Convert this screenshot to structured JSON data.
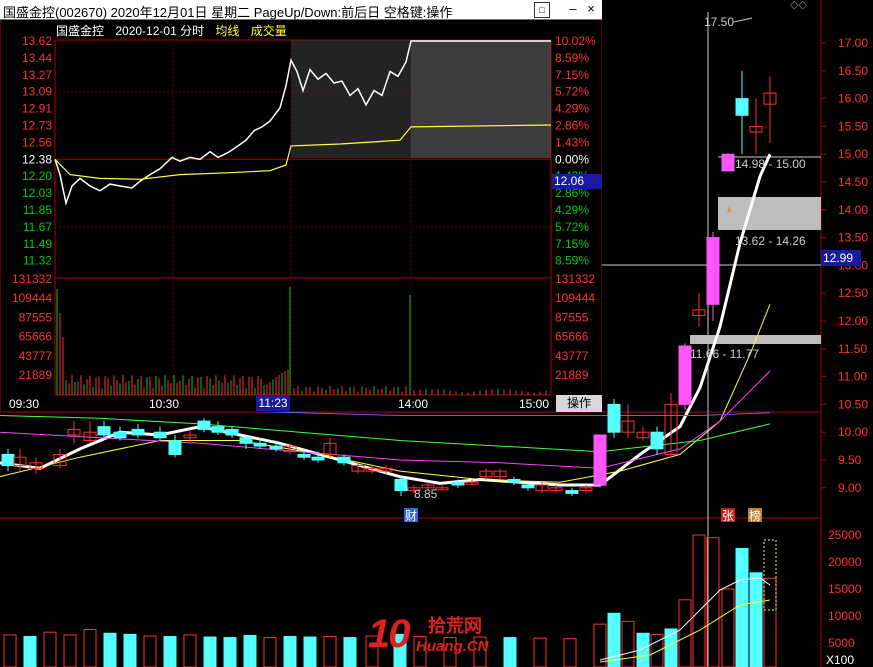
{
  "window": {
    "title": "国盛金控(002670) 2020年12月01日 星期二 PageUp/Down:前后日 空格键:操作",
    "operate_button": "操作"
  },
  "intraday": {
    "stock_name": "国盛金控",
    "date_label": "2020-12-01 分时",
    "legend_avg": "均线",
    "legend_vol": "成交量",
    "left_prices": [
      "13.62",
      "13.44",
      "13.27",
      "13.09",
      "12.91",
      "12.73",
      "12.56",
      "12.38",
      "12.20",
      "12.03",
      "11.85",
      "11.67",
      "11.49",
      "11.32"
    ],
    "right_pcts": [
      "10.02%",
      "8.59%",
      "7.15%",
      "5.72%",
      "4.29%",
      "2.86%",
      "1.43%",
      "0.00%",
      "1.43%",
      "2.86%",
      "4.29%",
      "5.72%",
      "7.15%",
      "8.59%"
    ],
    "vol_ticks": [
      "131332",
      "109444",
      "87555",
      "65666",
      "43777",
      "21889"
    ],
    "time_ticks": [
      "09:30",
      "10:30",
      "11:23",
      "14:00",
      "15:00"
    ],
    "current_time": "11:23",
    "current_price": "12.06",
    "colors": {
      "up": "#ff3030",
      "down": "#00cc00",
      "flat": "#ffffff",
      "avg": "#ffff40"
    }
  },
  "daily": {
    "price_ticks": [
      "17.00",
      "16.50",
      "16.00",
      "15.50",
      "15.00",
      "14.50",
      "14.00",
      "13.50",
      "13.00",
      "12.50",
      "12.00",
      "11.50",
      "11.00",
      "10.50",
      "10.00",
      "9.50",
      "9.00"
    ],
    "current_price": "12.99",
    "high_label": "17.50",
    "low_label": "8.85",
    "gap_labels": [
      "14.98 - 15.00",
      "13.62 - 14.26",
      "11.66 - 11.77"
    ],
    "markers": [
      "财",
      "张",
      "榜"
    ],
    "volume_ticks": [
      "25000",
      "20000",
      "15000",
      "10000",
      "5000"
    ],
    "volume_unit": "X100",
    "colors": {
      "up": "#ff3030",
      "down": "#54ffff",
      "limit": "#ff55ff"
    }
  },
  "brand": {
    "logo_number": "10",
    "logo_cn": "拾荒网",
    "logo_en": "Huang.CN"
  }
}
